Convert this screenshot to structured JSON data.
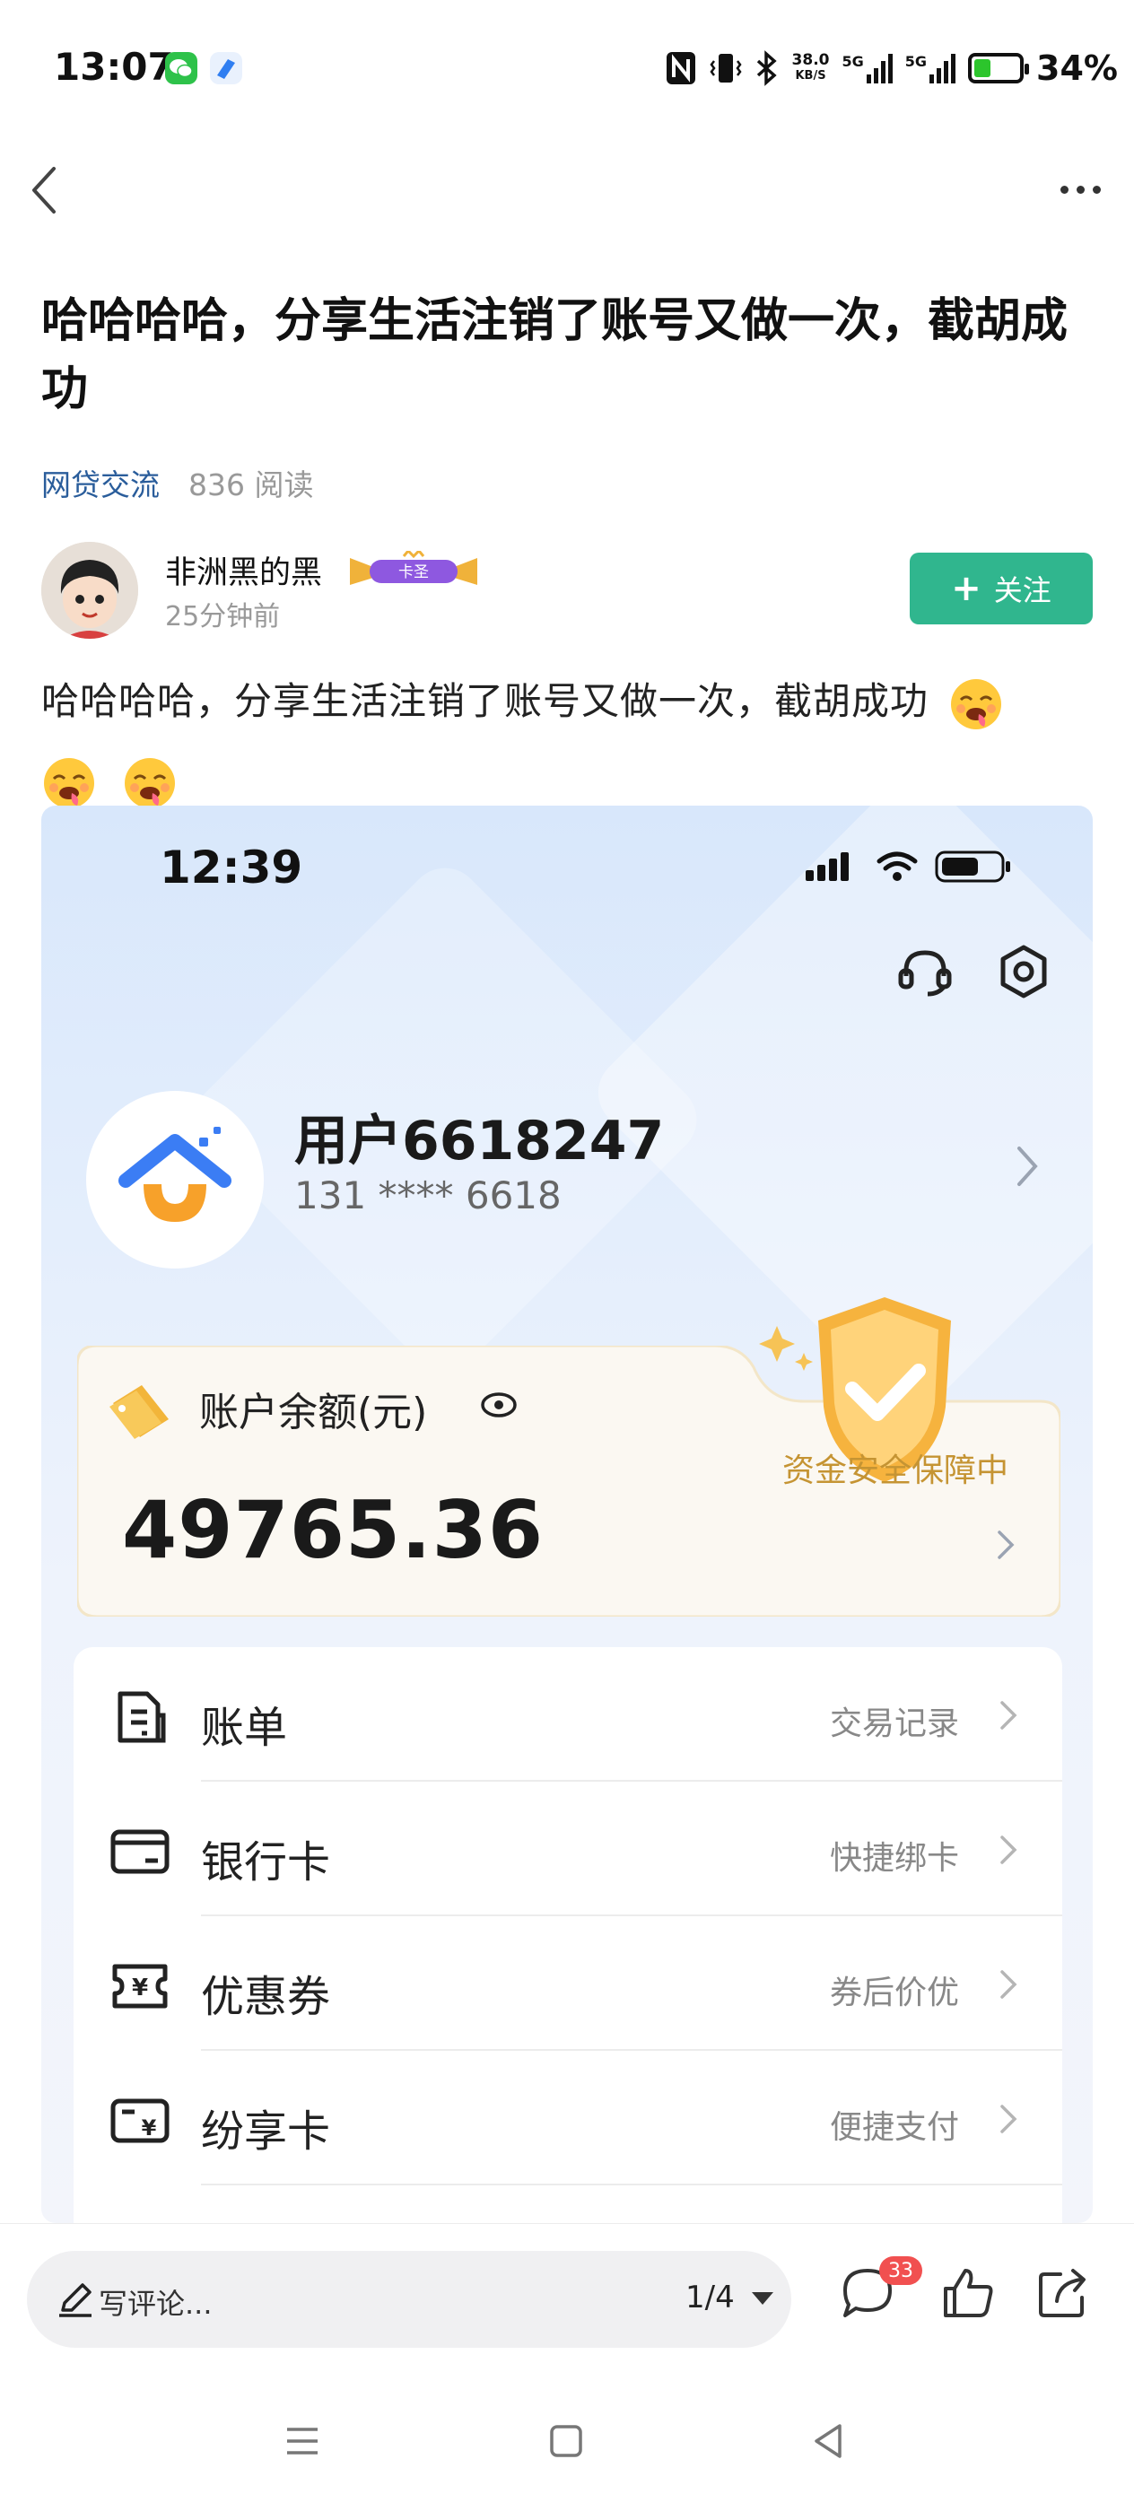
{
  "status_bar": {
    "time": "13:07",
    "net_speed_value": "38.0",
    "net_speed_unit": "KB/S",
    "sig1_label": "5G",
    "sig2_label": "5G",
    "battery_percent": "34%",
    "icons": [
      "wechat-icon",
      "app-icon",
      "nfc-icon",
      "vibrate-icon",
      "bluetooth-icon",
      "signal-icon",
      "battery-icon"
    ]
  },
  "post": {
    "title": "哈哈哈哈，分享生活注销了账号又做一次，截胡成功",
    "category": "网贷交流",
    "reads": "836 阅读",
    "body": "哈哈哈哈，分享生活注销了账号又做一次，截胡成功"
  },
  "author": {
    "name": "非洲黑的黑",
    "badge": "卡圣",
    "time": "25分钟前",
    "follow_label": "关注",
    "follow_color": "#30b68e"
  },
  "embedded": {
    "time": "12:39",
    "username": "用户6618247",
    "phone": "131 **** 6618",
    "balance_label": "账户余额(元)",
    "balance_value": "49765.36",
    "guarantee": "资金安全保障中",
    "menu": [
      {
        "label": "账单",
        "sub": "交易记录",
        "icon": "bill-icon"
      },
      {
        "label": "银行卡",
        "sub": "快捷绑卡",
        "icon": "bank-card-icon"
      },
      {
        "label": "优惠券",
        "sub": "券后价优",
        "icon": "coupon-icon"
      },
      {
        "label": "纷享卡",
        "sub": "便捷支付",
        "icon": "share-card-icon"
      }
    ]
  },
  "bottom_bar": {
    "comment_placeholder": "写评论...",
    "pager": "1/4",
    "comment_count": "33"
  },
  "colors": {
    "accent": "#30b68e",
    "link": "#2a5d9b",
    "badge_red": "#f15050",
    "gold": "#c59433"
  }
}
